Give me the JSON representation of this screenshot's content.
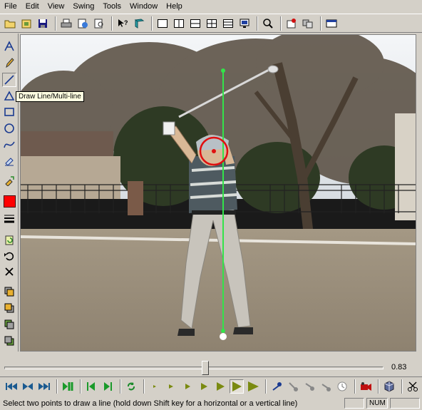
{
  "menu": [
    "File",
    "Edit",
    "View",
    "Swing",
    "Tools",
    "Window",
    "Help"
  ],
  "tooltip": "Draw Line/Multi-line",
  "slider": {
    "value": "0.83",
    "position": 0.53
  },
  "status": {
    "message": "Select two points to draw a line (hold down Shift key for a horizontal or a vertical line)",
    "num": "NUM"
  },
  "colors": {
    "current_color": "#ff0000",
    "guide_line": "#33e34a",
    "marker": "#e01010"
  },
  "icons": {
    "toolbar": [
      "open-folder-icon",
      "new-file-icon",
      "save-icon",
      "print-icon",
      "export-icon",
      "print-preview-icon",
      "help-cursor-icon",
      "book-icon",
      "layout-single-icon",
      "layout-two-vertical-icon",
      "layout-two-horizontal-icon",
      "layout-grid-icon",
      "layout-wide-icon",
      "monitor-icon",
      "zoom-icon",
      "record-icon",
      "compare-icon",
      "timeline-icon"
    ],
    "tools": [
      "text-tool-icon",
      "pencil-tool-icon",
      "line-tool-icon",
      "angle-tool-icon",
      "rectangle-tool-icon",
      "circle-tool-icon",
      "curve-tool-icon",
      "eraser-tool-icon",
      "fill-tool-icon",
      "color-swatch-icon",
      "line-width-icon",
      "refresh-icon",
      "undo-icon",
      "delete-icon",
      "layer-1-icon",
      "layer-2-icon",
      "layer-3-icon",
      "layer-4-icon"
    ],
    "playback": [
      "skip-first-icon",
      "step-back-frame-icon",
      "fast-forward-icon",
      "play-pause-icon",
      "previous-mark-icon",
      "next-mark-icon",
      "loop-icon",
      "speed-1-icon",
      "speed-2-icon",
      "speed-3-icon",
      "speed-4-icon",
      "speed-5-icon",
      "speed-6-icon",
      "speed-7-icon",
      "club-pose-1-icon",
      "club-pose-2-icon",
      "club-pose-3-icon",
      "club-pose-4-icon",
      "clock-icon",
      "camera-icon",
      "cube-icon",
      "scissors-icon"
    ]
  }
}
